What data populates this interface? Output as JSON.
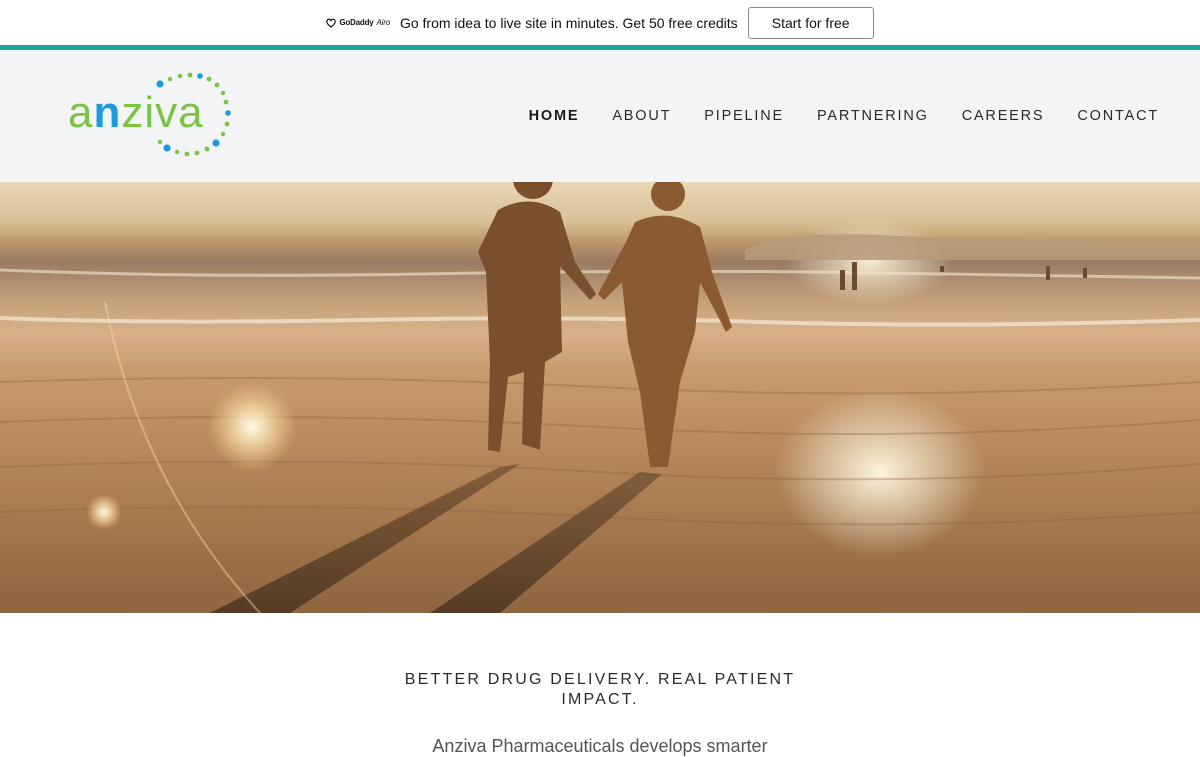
{
  "promo": {
    "brand_text_1": "GoDaddy",
    "brand_text_2": "Airo",
    "message": "Go from idea to live site in minutes. Get 50 free credits",
    "cta_label": "Start for free",
    "accent_color": "#18a9a6"
  },
  "header": {
    "logo_text": "anziva",
    "logo_colors": {
      "green": "#7cc243",
      "blue": "#1a9be0"
    },
    "nav": [
      {
        "label": "HOME",
        "active": true
      },
      {
        "label": "ABOUT",
        "active": false
      },
      {
        "label": "PIPELINE",
        "active": false
      },
      {
        "label": "PARTNERING",
        "active": false
      },
      {
        "label": "CAREERS",
        "active": false
      },
      {
        "label": "CONTACT",
        "active": false
      }
    ]
  },
  "content": {
    "tagline": "BETTER DRUG DELIVERY. REAL PATIENT IMPACT.",
    "intro": "Anziva Pharmaceuticals develops smarter"
  }
}
